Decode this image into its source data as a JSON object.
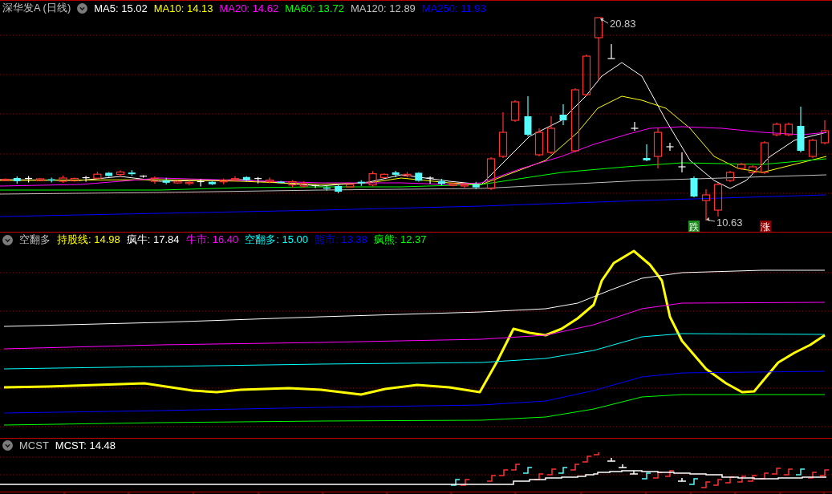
{
  "panels": [
    {
      "kind": "price",
      "title": "深华发A (日线)",
      "legend": [
        {
          "label": "MA5: 15.02",
          "color": "#ffffff"
        },
        {
          "label": "MA10: 14.13",
          "color": "#ffff00"
        },
        {
          "label": "MA20: 14.62",
          "color": "#ff00ff"
        },
        {
          "label": "MA60: 13.72",
          "color": "#00ff00"
        },
        {
          "label": "MA120: 12.89",
          "color": "#c0c0c0"
        },
        {
          "label": "MA250: 11.93",
          "color": "#0000ff"
        }
      ],
      "high_label": "20.83",
      "low_label": "10.63",
      "signals": [
        {
          "text": "跌",
          "color": "#1e8c1e"
        },
        {
          "text": "涨",
          "color": "#8c0000"
        }
      ]
    },
    {
      "kind": "indicator",
      "title": "空翻多",
      "legend": [
        {
          "label": "持股线: 14.98",
          "color": "#ffff00"
        },
        {
          "label": "疯牛: 17.84",
          "color": "#ffffff"
        },
        {
          "label": "牛市: 16.40",
          "color": "#ff00ff"
        },
        {
          "label": "空翻多: 15.00",
          "color": "#00ffff"
        },
        {
          "label": "熊市: 13.38",
          "color": "#0000ff"
        },
        {
          "label": "疯熊: 12.37",
          "color": "#00ff00"
        }
      ]
    },
    {
      "kind": "mcst",
      "title": "MCST",
      "legend": [
        {
          "label": "MCST: 14.48",
          "color": "#ffffff"
        }
      ]
    }
  ]
}
